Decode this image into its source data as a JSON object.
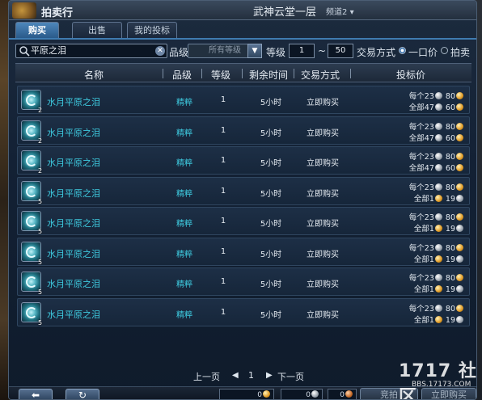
{
  "window": {
    "title": "拍卖行",
    "location": "武神云堂一层",
    "channel": "频道2",
    "close_glyph": "✕"
  },
  "tabs": [
    {
      "label": "购买",
      "active": true
    },
    {
      "label": "出售",
      "active": false
    },
    {
      "label": "我的投标",
      "active": false
    }
  ],
  "filters": {
    "search_value": "平原之泪",
    "grade_label": "品级",
    "grade_value": "所有等级",
    "level_label": "等级",
    "level_min": "1",
    "level_sep": "~",
    "level_max": "50",
    "trade_label": "交易方式",
    "trade_options": [
      {
        "label": "一口价",
        "selected": true
      },
      {
        "label": "拍卖",
        "selected": false
      }
    ]
  },
  "table": {
    "columns": [
      "名称",
      "品级",
      "等级",
      "剩余时间",
      "交易方式",
      "投标价"
    ],
    "rows": [
      {
        "name": "水月平原之泪",
        "count": "2",
        "grade": "精粹",
        "level": "1",
        "time": "5小时",
        "trade": "立即购买",
        "price_each_label": "每个",
        "price_each_a": "23",
        "price_each_b": "80",
        "price_each_coin": "gold",
        "price_all_label": "全部",
        "price_all_a": "47",
        "price_all_b": "60",
        "price_all_coin": "gold"
      },
      {
        "name": "水月平原之泪",
        "count": "2",
        "grade": "精粹",
        "level": "1",
        "time": "5小时",
        "trade": "立即购买",
        "price_each_label": "每个",
        "price_each_a": "23",
        "price_each_b": "80",
        "price_each_coin": "gold",
        "price_all_label": "全部",
        "price_all_a": "47",
        "price_all_b": "60",
        "price_all_coin": "gold"
      },
      {
        "name": "水月平原之泪",
        "count": "2",
        "grade": "精粹",
        "level": "1",
        "time": "5小时",
        "trade": "立即购买",
        "price_each_label": "每个",
        "price_each_a": "23",
        "price_each_b": "80",
        "price_each_coin": "gold",
        "price_all_label": "全部",
        "price_all_a": "47",
        "price_all_b": "60",
        "price_all_coin": "gold"
      },
      {
        "name": "水月平原之泪",
        "count": "5",
        "grade": "精粹",
        "level": "1",
        "time": "5小时",
        "trade": "立即购买",
        "price_each_label": "每个",
        "price_each_a": "23",
        "price_each_b": "80",
        "price_each_coin": "gold",
        "price_all_label": "全部",
        "price_all_a": "1",
        "price_all_b": "19",
        "price_all_coin": "silver"
      },
      {
        "name": "水月平原之泪",
        "count": "5",
        "grade": "精粹",
        "level": "1",
        "time": "5小时",
        "trade": "立即购买",
        "price_each_label": "每个",
        "price_each_a": "23",
        "price_each_b": "80",
        "price_each_coin": "gold",
        "price_all_label": "全部",
        "price_all_a": "1",
        "price_all_b": "19",
        "price_all_coin": "silver"
      },
      {
        "name": "水月平原之泪",
        "count": "5",
        "grade": "精粹",
        "level": "1",
        "time": "5小时",
        "trade": "立即购买",
        "price_each_label": "每个",
        "price_each_a": "23",
        "price_each_b": "80",
        "price_each_coin": "gold",
        "price_all_label": "全部",
        "price_all_a": "1",
        "price_all_b": "19",
        "price_all_coin": "silver"
      },
      {
        "name": "水月平原之泪",
        "count": "5",
        "grade": "精粹",
        "level": "1",
        "time": "5小时",
        "trade": "立即购买",
        "price_each_label": "每个",
        "price_each_a": "23",
        "price_each_b": "80",
        "price_each_coin": "gold",
        "price_all_label": "全部",
        "price_all_a": "1",
        "price_all_b": "19",
        "price_all_coin": "silver"
      },
      {
        "name": "水月平原之泪",
        "count": "5",
        "grade": "精粹",
        "level": "1",
        "time": "5小时",
        "trade": "立即购买",
        "price_each_label": "每个",
        "price_each_a": "23",
        "price_each_b": "80",
        "price_each_coin": "gold",
        "price_all_label": "全部",
        "price_all_a": "1",
        "price_all_b": "19",
        "price_all_coin": "silver"
      }
    ]
  },
  "pager": {
    "prev_label": "上一页",
    "current_page": "1",
    "next_label": "下一页"
  },
  "bottom": {
    "back_icon": "arrow-left-icon",
    "refresh_icon": "refresh-icon",
    "money_values": [
      "0",
      "0",
      "0"
    ],
    "bid_label": "竞拍",
    "buy_label": "立即购买"
  },
  "watermark": {
    "logo": "1717 社区",
    "url": "BBS.17173.COM"
  },
  "colors": {
    "accent": "#3f7bb0",
    "item_name": "#3ecbe0",
    "gold_coin": "#e09a23"
  }
}
